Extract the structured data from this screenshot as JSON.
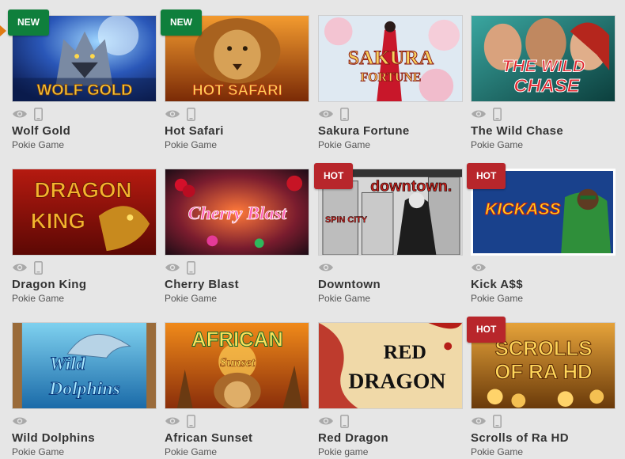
{
  "games": [
    {
      "title": "Wolf Gold",
      "subtitle": "Pokie Game",
      "badge": "NEW",
      "art_text": [
        "WOLF GOLD"
      ],
      "mobile": true
    },
    {
      "title": "Hot Safari",
      "subtitle": "Pokie Game",
      "badge": "NEW",
      "art_text": [
        "HOT SAFARI"
      ],
      "mobile": true
    },
    {
      "title": "Sakura Fortune",
      "subtitle": "Pokie Game",
      "badge": "",
      "art_text": [
        "SAKURA",
        "FORTUNE"
      ],
      "mobile": true
    },
    {
      "title": "The Wild Chase",
      "subtitle": "Pokie Game",
      "badge": "",
      "art_text": [
        "THE WILD",
        "CHASE"
      ],
      "mobile": true
    },
    {
      "title": "Dragon King",
      "subtitle": "Pokie Game",
      "badge": "",
      "art_text": [
        "DRAGON",
        "KING"
      ],
      "mobile": true
    },
    {
      "title": "Cherry Blast",
      "subtitle": "Pokie Game",
      "badge": "",
      "art_text": [
        "Cherry Blast"
      ],
      "mobile": true
    },
    {
      "title": "Downtown",
      "subtitle": "Pokie Game",
      "badge": "HOT",
      "art_text": [
        "downtown.",
        "SPIN CITY"
      ],
      "mobile": false
    },
    {
      "title": "Kick A$$",
      "subtitle": "Pokie Game",
      "badge": "HOT",
      "art_text": [
        "KICKASS"
      ],
      "mobile": false
    },
    {
      "title": "Wild Dolphins",
      "subtitle": "Pokie Game",
      "badge": "",
      "art_text": [
        "Wild",
        "Dolphins"
      ],
      "mobile": false
    },
    {
      "title": "African Sunset",
      "subtitle": "Pokie Game",
      "badge": "",
      "art_text": [
        "AFRICAN",
        "Sunset"
      ],
      "mobile": true
    },
    {
      "title": "Red Dragon",
      "subtitle": "Pokie game",
      "badge": "",
      "art_text": [
        "RED",
        "DRAGON"
      ],
      "mobile": true
    },
    {
      "title": "Scrolls of Ra HD",
      "subtitle": "Pokie Game",
      "badge": "HOT",
      "art_text": [
        "SCROLLS",
        "OF RA HD"
      ],
      "mobile": true
    }
  ],
  "colors": {
    "new_badge": "#0f7f3c",
    "hot_badge": "#b8262b",
    "title_text": "#333333",
    "page_bg": "#e6e6e6",
    "icon_gray": "#a9a9a9"
  },
  "icons": {
    "preview": "eye-icon",
    "mobile": "mobile-phone-icon",
    "carousel_marker": "arrow-right-icon"
  }
}
